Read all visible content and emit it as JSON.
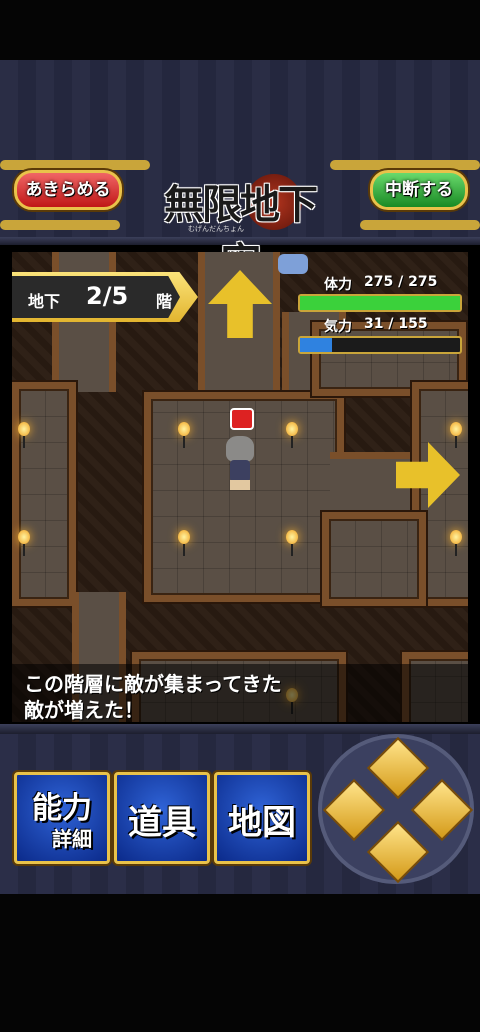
{
  "header": {
    "give_up_label": "あきらめる",
    "suspend_label": "中断する",
    "logo_title": "無限地下牢",
    "logo_subtitle": "むげんだんちょん"
  },
  "hud": {
    "floor_prefix": "地下",
    "floor_value": "2/5",
    "floor_suffix": "階",
    "hp": {
      "label": "体力",
      "text": "275 / 275",
      "current": 275,
      "max": 275,
      "color": "#3bd13b"
    },
    "spirit": {
      "label": "気力",
      "text": "31 / 155",
      "current": 31,
      "max": 155,
      "color": "#2f82e0"
    }
  },
  "message": {
    "line1": "この階層に敵が集まってきた",
    "line2": "敵が増えた！"
  },
  "menu": {
    "ability_line1": "能力",
    "ability_line2": "詳細",
    "items_label": "道具",
    "map_label": "地図"
  },
  "icons": [
    "up-arrow-icon",
    "right-arrow-icon",
    "dpad-up-icon",
    "dpad-left-icon",
    "dpad-right-icon",
    "dpad-down-icon",
    "lantern-icon"
  ]
}
